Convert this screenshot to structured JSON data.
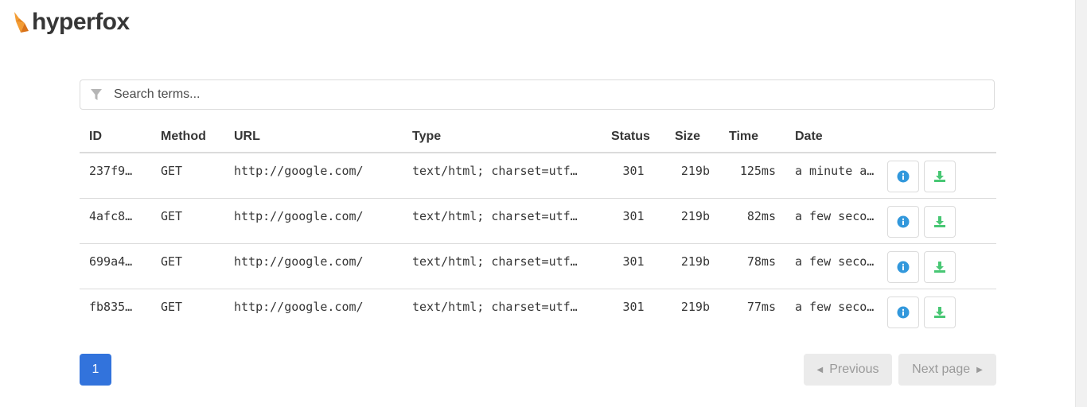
{
  "app": {
    "brand": "hyperfox"
  },
  "search": {
    "placeholder": "Search terms..."
  },
  "table": {
    "headers": {
      "id": "ID",
      "method": "Method",
      "url": "URL",
      "type": "Type",
      "status": "Status",
      "size": "Size",
      "time": "Time",
      "date": "Date"
    },
    "rows": [
      {
        "id": "237f9…",
        "method": "GET",
        "url": "http://google.com/",
        "type": "text/html; charset=utf…",
        "status": "301",
        "size": "219b",
        "time": "125ms",
        "date": "a minute a…"
      },
      {
        "id": "4afc8…",
        "method": "GET",
        "url": "http://google.com/",
        "type": "text/html; charset=utf…",
        "status": "301",
        "size": "219b",
        "time": "82ms",
        "date": "a few seco…"
      },
      {
        "id": "699a4…",
        "method": "GET",
        "url": "http://google.com/",
        "type": "text/html; charset=utf…",
        "status": "301",
        "size": "219b",
        "time": "78ms",
        "date": "a few seco…"
      },
      {
        "id": "fb835…",
        "method": "GET",
        "url": "http://google.com/",
        "type": "text/html; charset=utf…",
        "status": "301",
        "size": "219b",
        "time": "77ms",
        "date": "a few seco…"
      }
    ]
  },
  "pagination": {
    "current": "1",
    "previous_label": "Previous",
    "next_label": "Next page"
  },
  "icons": {
    "brand": "fox-logo-icon",
    "filter": "filter-icon",
    "info": "info-icon",
    "download": "download-icon"
  },
  "colors": {
    "accent": "#3273dc",
    "info": "#3298dc",
    "download": "#48c774",
    "fox": "#f39c33"
  }
}
